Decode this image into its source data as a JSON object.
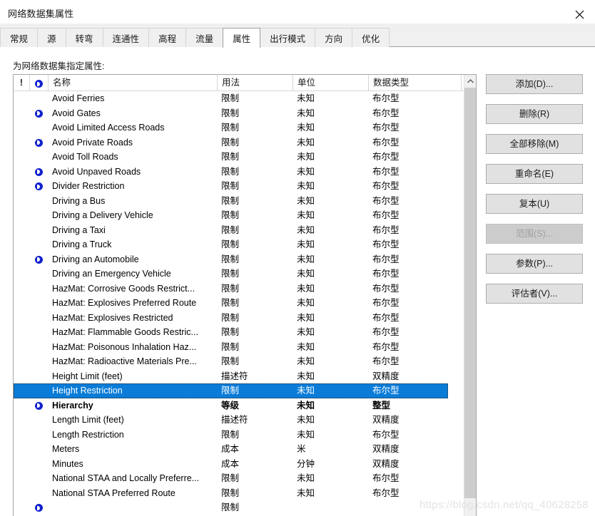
{
  "window": {
    "title": "网络数据集属性",
    "close_icon": "close-icon"
  },
  "tabs": [
    {
      "label": "常规",
      "selected": false
    },
    {
      "label": "源",
      "selected": false
    },
    {
      "label": "转弯",
      "selected": false
    },
    {
      "label": "连通性",
      "selected": false
    },
    {
      "label": "高程",
      "selected": false
    },
    {
      "label": "流量",
      "selected": false
    },
    {
      "label": "属性",
      "selected": true
    },
    {
      "label": "出行模式",
      "selected": false
    },
    {
      "label": "方向",
      "selected": false
    },
    {
      "label": "优化",
      "selected": false
    }
  ],
  "caption": "为网络数据集指定属性:",
  "grid": {
    "headers": {
      "warning": "!",
      "icon": "⊙",
      "name": "名称",
      "usage": "用法",
      "unit": "单位",
      "datatype": "数据类型"
    },
    "rows": [
      {
        "icon": false,
        "name": "Avoid Ferries",
        "usage": "限制",
        "unit": "未知",
        "datatype": "布尔型",
        "selected": false,
        "bold": false
      },
      {
        "icon": true,
        "name": "Avoid Gates",
        "usage": "限制",
        "unit": "未知",
        "datatype": "布尔型",
        "selected": false,
        "bold": false
      },
      {
        "icon": false,
        "name": "Avoid Limited Access Roads",
        "usage": "限制",
        "unit": "未知",
        "datatype": "布尔型",
        "selected": false,
        "bold": false
      },
      {
        "icon": true,
        "name": "Avoid Private Roads",
        "usage": "限制",
        "unit": "未知",
        "datatype": "布尔型",
        "selected": false,
        "bold": false
      },
      {
        "icon": false,
        "name": "Avoid Toll Roads",
        "usage": "限制",
        "unit": "未知",
        "datatype": "布尔型",
        "selected": false,
        "bold": false
      },
      {
        "icon": true,
        "name": "Avoid Unpaved Roads",
        "usage": "限制",
        "unit": "未知",
        "datatype": "布尔型",
        "selected": false,
        "bold": false
      },
      {
        "icon": true,
        "name": "Divider Restriction",
        "usage": "限制",
        "unit": "未知",
        "datatype": "布尔型",
        "selected": false,
        "bold": false
      },
      {
        "icon": false,
        "name": "Driving a Bus",
        "usage": "限制",
        "unit": "未知",
        "datatype": "布尔型",
        "selected": false,
        "bold": false
      },
      {
        "icon": false,
        "name": "Driving a Delivery Vehicle",
        "usage": "限制",
        "unit": "未知",
        "datatype": "布尔型",
        "selected": false,
        "bold": false
      },
      {
        "icon": false,
        "name": "Driving a Taxi",
        "usage": "限制",
        "unit": "未知",
        "datatype": "布尔型",
        "selected": false,
        "bold": false
      },
      {
        "icon": false,
        "name": "Driving a Truck",
        "usage": "限制",
        "unit": "未知",
        "datatype": "布尔型",
        "selected": false,
        "bold": false
      },
      {
        "icon": true,
        "name": "Driving an Automobile",
        "usage": "限制",
        "unit": "未知",
        "datatype": "布尔型",
        "selected": false,
        "bold": false
      },
      {
        "icon": false,
        "name": "Driving an Emergency Vehicle",
        "usage": "限制",
        "unit": "未知",
        "datatype": "布尔型",
        "selected": false,
        "bold": false
      },
      {
        "icon": false,
        "name": "HazMat: Corrosive Goods Restrict...",
        "usage": "限制",
        "unit": "未知",
        "datatype": "布尔型",
        "selected": false,
        "bold": false
      },
      {
        "icon": false,
        "name": "HazMat: Explosives Preferred Route",
        "usage": "限制",
        "unit": "未知",
        "datatype": "布尔型",
        "selected": false,
        "bold": false
      },
      {
        "icon": false,
        "name": "HazMat: Explosives Restricted",
        "usage": "限制",
        "unit": "未知",
        "datatype": "布尔型",
        "selected": false,
        "bold": false
      },
      {
        "icon": false,
        "name": "HazMat: Flammable Goods Restric...",
        "usage": "限制",
        "unit": "未知",
        "datatype": "布尔型",
        "selected": false,
        "bold": false
      },
      {
        "icon": false,
        "name": "HazMat: Poisonous Inhalation Haz...",
        "usage": "限制",
        "unit": "未知",
        "datatype": "布尔型",
        "selected": false,
        "bold": false
      },
      {
        "icon": false,
        "name": "HazMat: Radioactive Materials Pre...",
        "usage": "限制",
        "unit": "未知",
        "datatype": "布尔型",
        "selected": false,
        "bold": false
      },
      {
        "icon": false,
        "name": "Height Limit (feet)",
        "usage": "描述符",
        "unit": "未知",
        "datatype": "双精度",
        "selected": false,
        "bold": false
      },
      {
        "icon": false,
        "name": "Height Restriction",
        "usage": "限制",
        "unit": "未知",
        "datatype": "布尔型",
        "selected": true,
        "bold": false
      },
      {
        "icon": true,
        "name": "Hierarchy",
        "usage": "等级",
        "unit": "未知",
        "datatype": "整型",
        "selected": false,
        "bold": true
      },
      {
        "icon": false,
        "name": "Length Limit (feet)",
        "usage": "描述符",
        "unit": "未知",
        "datatype": "双精度",
        "selected": false,
        "bold": false
      },
      {
        "icon": false,
        "name": "Length Restriction",
        "usage": "限制",
        "unit": "未知",
        "datatype": "布尔型",
        "selected": false,
        "bold": false
      },
      {
        "icon": false,
        "name": "Meters",
        "usage": "成本",
        "unit": "米",
        "datatype": "双精度",
        "selected": false,
        "bold": false
      },
      {
        "icon": false,
        "name": "Minutes",
        "usage": "成本",
        "unit": "分钟",
        "datatype": "双精度",
        "selected": false,
        "bold": false
      },
      {
        "icon": false,
        "name": "National STAA and Locally Preferre...",
        "usage": "限制",
        "unit": "未知",
        "datatype": "布尔型",
        "selected": false,
        "bold": false
      },
      {
        "icon": false,
        "name": "National STAA Preferred Route",
        "usage": "限制",
        "unit": "未知",
        "datatype": "布尔型",
        "selected": false,
        "bold": false
      },
      {
        "icon": true,
        "name": "",
        "usage": "限制",
        "unit": "",
        "datatype": "",
        "selected": false,
        "bold": false
      }
    ]
  },
  "scrollbar": {
    "up_icon": "chevron-up-icon"
  },
  "buttons": [
    {
      "label": "添加(D)...",
      "disabled": false,
      "name": "add-button"
    },
    {
      "label": "删除(R)",
      "disabled": false,
      "name": "delete-button"
    },
    {
      "label": "全部移除(M)",
      "disabled": false,
      "name": "remove-all-button"
    },
    {
      "label": "重命名(E)",
      "disabled": false,
      "name": "rename-button"
    },
    {
      "label": "复本(U)",
      "disabled": false,
      "name": "duplicate-button"
    },
    {
      "label": "范围(S)...",
      "disabled": true,
      "name": "range-button"
    },
    {
      "label": "参数(P)...",
      "disabled": false,
      "name": "parameters-button"
    },
    {
      "label": "评估者(V)...",
      "disabled": false,
      "name": "evaluators-button"
    }
  ],
  "watermark": "https://blog.csdn.net/qq_40628258",
  "colors": {
    "selection": "#0a7cd8",
    "icon_blue": "#1122cc",
    "button_face": "#e1e1e1",
    "window_bg": "#ffffff"
  }
}
